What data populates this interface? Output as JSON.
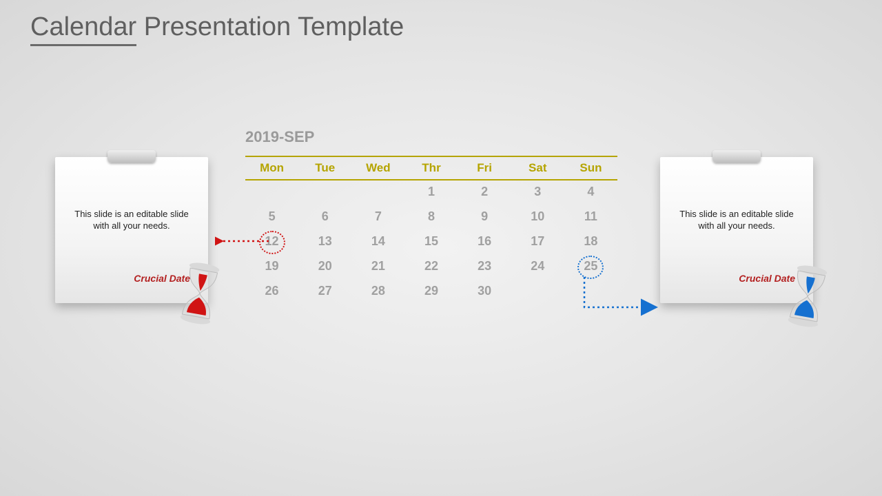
{
  "title": {
    "underlined": "Calendar",
    "rest": " Presentation Template"
  },
  "calendar": {
    "month": "2019-SEP",
    "weekdays": [
      "Mon",
      "Tue",
      "Wed",
      "Thr",
      "Fri",
      "Sat",
      "Sun"
    ],
    "rows": [
      [
        "",
        "",
        "",
        "1",
        "2",
        "3",
        "4"
      ],
      [
        "5",
        "6",
        "7",
        "8",
        "9",
        "10",
        "11"
      ],
      [
        "12",
        "13",
        "14",
        "15",
        "16",
        "17",
        "18"
      ],
      [
        "19",
        "20",
        "21",
        "22",
        "23",
        "24",
        "25"
      ],
      [
        "26",
        "27",
        "28",
        "29",
        "30",
        "",
        ""
      ]
    ],
    "highlight_red": "12",
    "highlight_blue": "25"
  },
  "notes": {
    "left": {
      "text": "This slide is an editable slide with all your needs.",
      "label": "Crucial Date"
    },
    "right": {
      "text": "This slide is an editable slide with all your needs.",
      "label": "Crucial Date"
    }
  },
  "colors": {
    "accent_red": "#d01414",
    "accent_blue": "#1570d0"
  }
}
